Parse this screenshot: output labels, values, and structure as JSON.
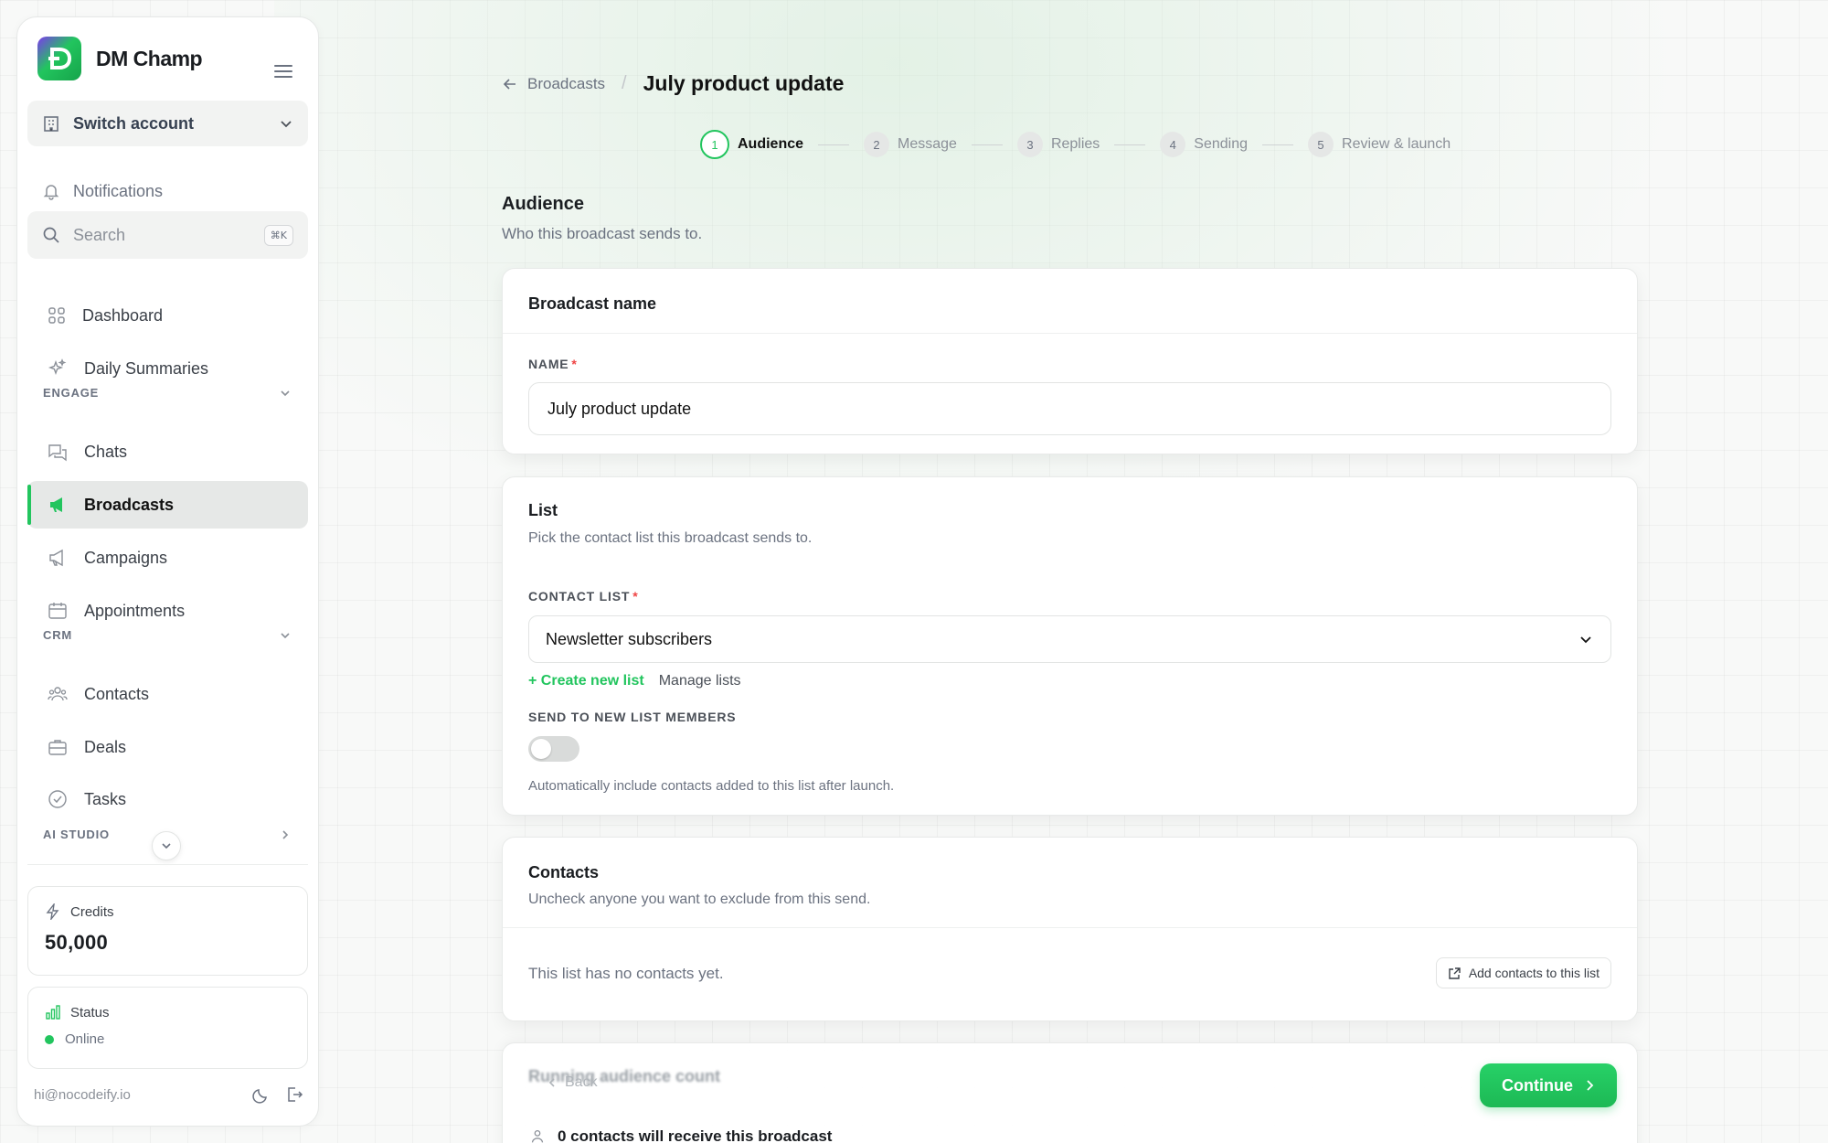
{
  "sidebar": {
    "brand": "DM Champ",
    "switch_account": "Switch account",
    "notifications": "Notifications",
    "search": {
      "placeholder": "Search",
      "shortcut": "⌘K"
    },
    "items": {
      "dashboard": "Dashboard",
      "daily_summaries": "Daily Summaries",
      "chats": "Chats",
      "broadcasts": "Broadcasts",
      "campaigns": "Campaigns",
      "appointments": "Appointments",
      "contacts": "Contacts",
      "deals": "Deals",
      "tasks": "Tasks"
    },
    "sections": {
      "engage": "ENGAGE",
      "crm": "CRM",
      "ai_studio": "AI STUDIO"
    },
    "credits": {
      "label": "Credits",
      "value": "50,000"
    },
    "status": {
      "label": "Status",
      "value": "Online",
      "color": "#22c55e"
    },
    "email": "hi@nocodeify.io"
  },
  "header": {
    "back_link": "Broadcasts",
    "title": "July product update"
  },
  "steps": [
    {
      "num": "1",
      "label": "Audience",
      "active": true
    },
    {
      "num": "2",
      "label": "Message"
    },
    {
      "num": "3",
      "label": "Replies"
    },
    {
      "num": "4",
      "label": "Sending"
    },
    {
      "num": "5",
      "label": "Review & launch"
    }
  ],
  "section": {
    "title": "Audience",
    "subtitle": "Who this broadcast sends to."
  },
  "name_card": {
    "title": "Broadcast name",
    "field_label": "NAME",
    "value": "July product update"
  },
  "list_card": {
    "title": "List",
    "subtitle": "Pick the contact list this broadcast sends to.",
    "field_label": "CONTACT LIST",
    "selected": "Newsletter subscribers",
    "create_link": "+ Create new list",
    "manage_link": "Manage lists",
    "toggle_label": "SEND TO NEW LIST MEMBERS",
    "toggle_on": false,
    "toggle_help": "Automatically include contacts added to this list after launch."
  },
  "contacts_card": {
    "title": "Contacts",
    "subtitle": "Uncheck anyone you want to exclude from this send.",
    "empty": "This list has no contacts yet.",
    "add_button": "Add contacts to this list"
  },
  "footer": {
    "running_count": "Running audience count",
    "back": "Back",
    "continue": "Continue",
    "count_text": "0 contacts will receive this broadcast"
  },
  "colors": {
    "accent": "#22c55e",
    "required": "#ef4444"
  }
}
